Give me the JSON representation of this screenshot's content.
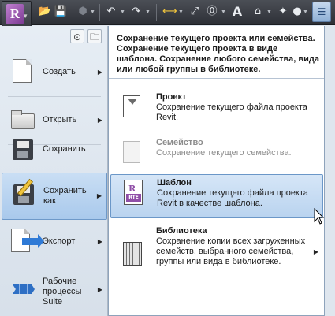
{
  "toolbar": {
    "app_letter": "R",
    "icons": [
      "open-folder",
      "save",
      "sync",
      "undo",
      "redo",
      "measure",
      "dimension",
      "tag",
      "text",
      "3d-view",
      "section",
      "thin-lines",
      "switch-windows"
    ],
    "text_tool_letter": "A"
  },
  "left_menu": {
    "items": [
      {
        "label": "Создать",
        "icon": "new-document",
        "has_submenu": true,
        "selected": false
      },
      {
        "label": "Открыть",
        "icon": "open-folder",
        "has_submenu": true,
        "selected": false
      },
      {
        "label": "Сохранить",
        "icon": "save-disk",
        "has_submenu": false,
        "selected": false
      },
      {
        "label": "Сохранить как",
        "icon": "save-as",
        "has_submenu": true,
        "selected": true
      },
      {
        "label": "Экспорт",
        "icon": "export-arrow",
        "has_submenu": true,
        "selected": false
      },
      {
        "label": "Рабочие процессы Suite",
        "icon": "suite-workflows",
        "has_submenu": true,
        "selected": false
      }
    ]
  },
  "right_panel": {
    "intro": "Сохранение текущего проекта или семейства. Сохранение текущего проекта в виде шаблона. Сохранение любого семейства, вида или любой группы в библиотеке.",
    "options": [
      {
        "title": "Проект",
        "desc": "Сохранение текущего файла проекта Revit.",
        "icon": "project-file",
        "enabled": true,
        "selected": false,
        "has_submenu": false
      },
      {
        "title": "Семейство",
        "desc": "Сохранение текущего семейства.",
        "icon": "family-file",
        "enabled": false,
        "selected": false,
        "has_submenu": false
      },
      {
        "title": "Шаблон",
        "desc": "Сохранение текущего файла проекта Revit в качестве шаблона.",
        "icon": "template-file",
        "badge": "RTE",
        "enabled": true,
        "selected": true,
        "has_submenu": false
      },
      {
        "title": "Библиотека",
        "desc": "Сохранение копии всех загруженных семейств, выбранного семейства, группы или вида в библиотеке.",
        "icon": "library",
        "enabled": true,
        "selected": false,
        "has_submenu": true
      }
    ]
  },
  "colors": {
    "selection_fill": "#b9d3ef",
    "selection_border": "#6b97c8",
    "toolbar_bg": "#2d3036",
    "revit_purple": "#8f4ea7"
  }
}
